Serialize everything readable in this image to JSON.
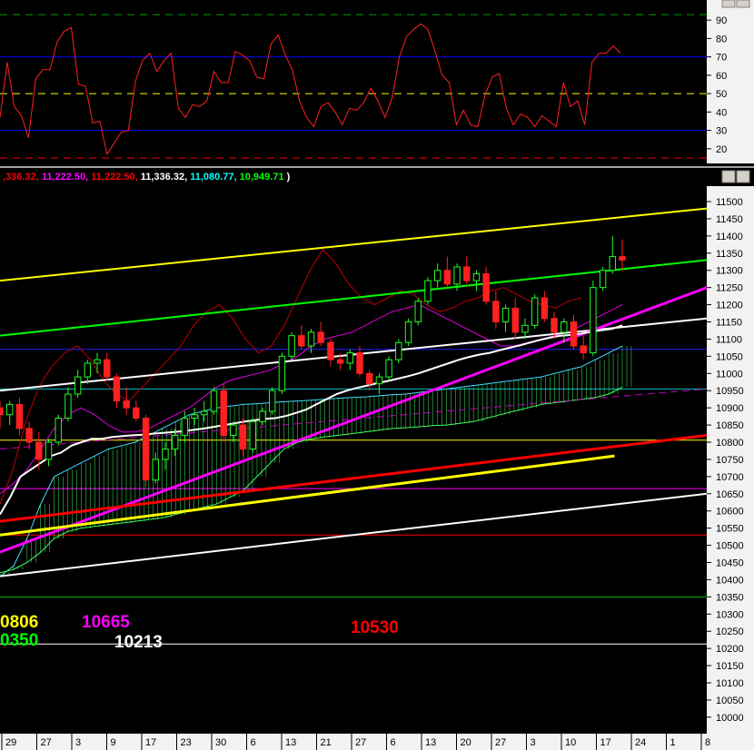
{
  "window": {
    "buttons": [
      {
        "name": "window-restore-icon"
      },
      {
        "name": "window-close-icon"
      }
    ]
  },
  "header": {
    "ohlc_segments": [
      {
        "text": ",336.32, ",
        "color": "#ff0000"
      },
      {
        "text": "11,222.50, ",
        "color": "#ff00ff"
      },
      {
        "text": "11,222.50, ",
        "color": "#ff0000"
      },
      {
        "text": "11,336.32, ",
        "color": "#ffffff"
      },
      {
        "text": "11,080.77, ",
        "color": "#00ffff"
      },
      {
        "text": "10,949.71",
        "color": "#00ff00"
      },
      {
        "text": " )",
        "color": "#ffffff"
      }
    ]
  },
  "chart_data": [
    {
      "type": "line",
      "name": "oscillator",
      "ylim": [
        13,
        97
      ],
      "yticks": [
        90,
        80,
        70,
        60,
        50,
        40,
        30,
        20
      ],
      "reference_lines": [
        {
          "value": 93,
          "color": "#00a000",
          "style": "dashed"
        },
        {
          "value": 70,
          "color": "#0000ff",
          "style": "solid"
        },
        {
          "value": 50,
          "color": "#ffff00",
          "style": "dashed"
        },
        {
          "value": 30,
          "color": "#0000ff",
          "style": "solid"
        },
        {
          "value": 15,
          "color": "#ff0000",
          "style": "dashed"
        }
      ],
      "series": [
        {
          "color": "#ff2020",
          "values": [
            37,
            67,
            43,
            38,
            26,
            58,
            63,
            63,
            78,
            84,
            86,
            55,
            54,
            34,
            35,
            17,
            23,
            29,
            30,
            57,
            68,
            72,
            62,
            68,
            72,
            42,
            37,
            44,
            43,
            46,
            62,
            56,
            56,
            73,
            71,
            68,
            59,
            58,
            77,
            82,
            71,
            63,
            46,
            37,
            32,
            43,
            45,
            40,
            33,
            42,
            41,
            45,
            53,
            46,
            37,
            48,
            70,
            81,
            85,
            88,
            85,
            73,
            60,
            56,
            33,
            41,
            33,
            32,
            49,
            59,
            61,
            42,
            33,
            39,
            37,
            32,
            38,
            35,
            32,
            56,
            43,
            46,
            33,
            67,
            72,
            72,
            76,
            72
          ]
        }
      ]
    },
    {
      "type": "candlestick",
      "name": "price",
      "ylim": [
        9960,
        11545
      ],
      "yticks": [
        11500,
        11450,
        11400,
        11350,
        11300,
        11250,
        11200,
        11150,
        11100,
        11050,
        11000,
        10950,
        10900,
        10850,
        10800,
        10750,
        10700,
        10650,
        10600,
        10550,
        10500,
        10450,
        10400,
        10350,
        10300,
        10250,
        10200,
        10150,
        10100,
        10050,
        10000
      ],
      "x_labels": [
        "29",
        "27",
        "3",
        "9",
        "17",
        "23",
        "30",
        "6",
        "13",
        "21",
        "27",
        "6",
        "13",
        "20",
        "27",
        "3",
        "10",
        "17",
        "24",
        "1",
        "8"
      ],
      "candles": [
        {
          "o": 10900,
          "h": 10920,
          "l": 10840,
          "c": 10880
        },
        {
          "o": 10880,
          "h": 10920,
          "l": 10850,
          "c": 10910
        },
        {
          "o": 10910,
          "h": 10930,
          "l": 10820,
          "c": 10840
        },
        {
          "o": 10840,
          "h": 10860,
          "l": 10780,
          "c": 10800
        },
        {
          "o": 10800,
          "h": 10830,
          "l": 10720,
          "c": 10750
        },
        {
          "o": 10750,
          "h": 10810,
          "l": 10730,
          "c": 10800
        },
        {
          "o": 10800,
          "h": 10880,
          "l": 10790,
          "c": 10870
        },
        {
          "o": 10870,
          "h": 10960,
          "l": 10860,
          "c": 10940
        },
        {
          "o": 10940,
          "h": 11010,
          "l": 10930,
          "c": 10990
        },
        {
          "o": 10990,
          "h": 11040,
          "l": 10970,
          "c": 11030
        },
        {
          "o": 11030,
          "h": 11060,
          "l": 11000,
          "c": 11040
        },
        {
          "o": 11040,
          "h": 11060,
          "l": 10980,
          "c": 10990
        },
        {
          "o": 10990,
          "h": 11000,
          "l": 10900,
          "c": 10920
        },
        {
          "o": 10920,
          "h": 10960,
          "l": 10880,
          "c": 10900
        },
        {
          "o": 10900,
          "h": 10920,
          "l": 10860,
          "c": 10870
        },
        {
          "o": 10870,
          "h": 10880,
          "l": 10670,
          "c": 10690
        },
        {
          "o": 10690,
          "h": 10770,
          "l": 10680,
          "c": 10750
        },
        {
          "o": 10750,
          "h": 10800,
          "l": 10720,
          "c": 10780
        },
        {
          "o": 10780,
          "h": 10840,
          "l": 10760,
          "c": 10820
        },
        {
          "o": 10820,
          "h": 10890,
          "l": 10800,
          "c": 10870
        },
        {
          "o": 10870,
          "h": 10900,
          "l": 10850,
          "c": 10880
        },
        {
          "o": 10880,
          "h": 10920,
          "l": 10860,
          "c": 10890
        },
        {
          "o": 10890,
          "h": 10960,
          "l": 10880,
          "c": 10950
        },
        {
          "o": 10950,
          "h": 10970,
          "l": 10800,
          "c": 10820
        },
        {
          "o": 10820,
          "h": 10860,
          "l": 10800,
          "c": 10850
        },
        {
          "o": 10850,
          "h": 10870,
          "l": 10760,
          "c": 10780
        },
        {
          "o": 10780,
          "h": 10870,
          "l": 10770,
          "c": 10860
        },
        {
          "o": 10860,
          "h": 10900,
          "l": 10850,
          "c": 10890
        },
        {
          "o": 10890,
          "h": 10960,
          "l": 10880,
          "c": 10950
        },
        {
          "o": 10950,
          "h": 11060,
          "l": 10940,
          "c": 11050
        },
        {
          "o": 11050,
          "h": 11120,
          "l": 11040,
          "c": 11110
        },
        {
          "o": 11110,
          "h": 11140,
          "l": 11070,
          "c": 11080
        },
        {
          "o": 11080,
          "h": 11130,
          "l": 11060,
          "c": 11120
        },
        {
          "o": 11120,
          "h": 11150,
          "l": 11080,
          "c": 11090
        },
        {
          "o": 11090,
          "h": 11100,
          "l": 11020,
          "c": 11040
        },
        {
          "o": 11040,
          "h": 11060,
          "l": 11010,
          "c": 11030
        },
        {
          "o": 11030,
          "h": 11070,
          "l": 11010,
          "c": 11060
        },
        {
          "o": 11060,
          "h": 11080,
          "l": 10990,
          "c": 11000
        },
        {
          "o": 11000,
          "h": 11010,
          "l": 10950,
          "c": 10970
        },
        {
          "o": 10970,
          "h": 11000,
          "l": 10940,
          "c": 10990
        },
        {
          "o": 10990,
          "h": 11050,
          "l": 10980,
          "c": 11040
        },
        {
          "o": 11040,
          "h": 11100,
          "l": 11030,
          "c": 11090
        },
        {
          "o": 11090,
          "h": 11160,
          "l": 11080,
          "c": 11150
        },
        {
          "o": 11150,
          "h": 11220,
          "l": 11140,
          "c": 11210
        },
        {
          "o": 11210,
          "h": 11280,
          "l": 11200,
          "c": 11270
        },
        {
          "o": 11270,
          "h": 11320,
          "l": 11250,
          "c": 11300
        },
        {
          "o": 11300,
          "h": 11340,
          "l": 11250,
          "c": 11260
        },
        {
          "o": 11260,
          "h": 11320,
          "l": 11240,
          "c": 11310
        },
        {
          "o": 11310,
          "h": 11340,
          "l": 11260,
          "c": 11270
        },
        {
          "o": 11270,
          "h": 11300,
          "l": 11240,
          "c": 11290
        },
        {
          "o": 11290,
          "h": 11310,
          "l": 11200,
          "c": 11210
        },
        {
          "o": 11210,
          "h": 11240,
          "l": 11130,
          "c": 11150
        },
        {
          "o": 11150,
          "h": 11200,
          "l": 11120,
          "c": 11190
        },
        {
          "o": 11190,
          "h": 11220,
          "l": 11100,
          "c": 11120
        },
        {
          "o": 11120,
          "h": 11160,
          "l": 11100,
          "c": 11140
        },
        {
          "o": 11140,
          "h": 11230,
          "l": 11130,
          "c": 11220
        },
        {
          "o": 11220,
          "h": 11240,
          "l": 11150,
          "c": 11160
        },
        {
          "o": 11160,
          "h": 11180,
          "l": 11100,
          "c": 11120
        },
        {
          "o": 11120,
          "h": 11160,
          "l": 11090,
          "c": 11150
        },
        {
          "o": 11150,
          "h": 11170,
          "l": 11070,
          "c": 11080
        },
        {
          "o": 11080,
          "h": 11110,
          "l": 11040,
          "c": 11060
        },
        {
          "o": 11060,
          "h": 11270,
          "l": 11050,
          "c": 11250
        },
        {
          "o": 11250,
          "h": 11310,
          "l": 11240,
          "c": 11300
        },
        {
          "o": 11300,
          "h": 11400,
          "l": 11290,
          "c": 11340
        },
        {
          "o": 11340,
          "h": 11390,
          "l": 11300,
          "c": 11330
        }
      ],
      "guide_lines": [
        {
          "from": [
            0,
            11270
          ],
          "to": [
            92,
            11480
          ],
          "color": "#ffff00",
          "width": 2
        },
        {
          "from": [
            0,
            11110
          ],
          "to": [
            92,
            11330
          ],
          "color": "#00ff00",
          "width": 2
        },
        {
          "from": [
            0,
            10950
          ],
          "to": [
            92,
            11160
          ],
          "color": "#ffffff",
          "width": 2
        },
        {
          "from": [
            0,
            10480
          ],
          "to": [
            92,
            11250
          ],
          "color": "#ff00ff",
          "width": 3
        },
        {
          "from": [
            0,
            10570
          ],
          "to": [
            92,
            10820
          ],
          "color": "#ff0000",
          "width": 3
        },
        {
          "from": [
            0,
            10530
          ],
          "to": [
            80,
            10760
          ],
          "color": "#ffff00",
          "width": 3
        },
        {
          "from": [
            0,
            10410
          ],
          "to": [
            92,
            10650
          ],
          "color": "#ffffff",
          "width": 2
        },
        {
          "from": [
            0,
            10780
          ],
          "to": [
            92,
            10955
          ],
          "color": "#c000c0",
          "width": 1,
          "dash": true
        }
      ],
      "horizontal_lines": [
        {
          "value": 11070,
          "color": "#2020ff"
        },
        {
          "value": 10955,
          "color": "#00c0c0"
        },
        {
          "value": 10806,
          "color": "#ffff00"
        },
        {
          "value": 10665,
          "color": "#ff00ff"
        },
        {
          "value": 10530,
          "color": "#ff0000"
        },
        {
          "value": 10350,
          "color": "#00c000"
        },
        {
          "value": 10213,
          "color": "#ffffff"
        }
      ],
      "level_labels": [
        {
          "text": "0806",
          "color": "#ffff00",
          "pos": "a"
        },
        {
          "text": "0350",
          "color": "#00ff00",
          "pos": "b"
        },
        {
          "text": "10665",
          "color": "#ff00ff",
          "pos": "c"
        },
        {
          "text": "10213",
          "color": "#ffffff",
          "pos": "d"
        },
        {
          "text": "10530",
          "color": "#ff0000",
          "pos": "e"
        }
      ],
      "ma_white": [
        10590,
        10640,
        10700,
        10720,
        10740,
        10760,
        10770,
        10790,
        10800,
        10810,
        10810,
        10815,
        10818,
        10820,
        10822,
        10825,
        10827,
        10830,
        10832,
        10836,
        10840,
        10845,
        10850,
        10855,
        10860,
        10864,
        10868,
        10870,
        10876,
        10885,
        10895,
        10910,
        10925,
        10940,
        10950,
        10958,
        10965,
        10972,
        10978,
        10985,
        10992,
        11000,
        11010,
        11020,
        11030,
        11040,
        11048,
        11055,
        11060,
        11068,
        11075,
        11082,
        11090,
        11098,
        11105,
        11110,
        11112,
        11116,
        11122,
        11126,
        11130,
        11140
      ],
      "ma_magenta": [
        10650,
        10680,
        10720,
        10780,
        10840,
        10880,
        10900,
        10880,
        10850,
        10830,
        10830,
        10840,
        10860,
        10880,
        10900,
        10930,
        10960,
        10980,
        10990,
        11000,
        11010,
        11030,
        11050,
        11080,
        11100,
        11110,
        11120,
        11140,
        11160,
        11180,
        11190,
        11200,
        11180,
        11160,
        11140,
        11120,
        11100,
        11080,
        11080,
        11090,
        11100,
        11110,
        11120,
        11140,
        11160,
        11180,
        11200
      ],
      "lagging_red": [
        10620,
        10720,
        10860,
        10960,
        11020,
        11060,
        11080,
        11040,
        10980,
        10940,
        10920,
        10960,
        11000,
        11040,
        11080,
        11140,
        11180,
        11200,
        11160,
        11100,
        11060,
        11080,
        11140,
        11220,
        11300,
        11360,
        11320,
        11260,
        11220,
        11200,
        11220,
        11240,
        11230,
        11200,
        11180,
        11190,
        11210,
        11220,
        11240,
        11250,
        11230,
        11210,
        11200,
        11190,
        11210,
        11220
      ],
      "cloud_top": [
        10410,
        10440,
        10520,
        10620,
        10700,
        10720,
        10740,
        10760,
        10780,
        10790,
        10800,
        10820,
        10840,
        10860,
        10880,
        10890,
        10900,
        10905,
        10910,
        10912,
        10915,
        10918,
        10920,
        10922,
        10925,
        10928,
        10930,
        10932,
        10935,
        10938,
        10940,
        10945,
        10950,
        10955,
        10960,
        10965,
        10970,
        10975,
        10980,
        10985,
        10990,
        11000,
        11010,
        11020,
        11040,
        11060,
        11080
      ],
      "cloud_bottom": [
        10420,
        10430,
        10450,
        10480,
        10520,
        10540,
        10550,
        10555,
        10560,
        10565,
        10570,
        10575,
        10580,
        10590,
        10600,
        10610,
        10620,
        10640,
        10660,
        10700,
        10740,
        10780,
        10800,
        10810,
        10815,
        10820,
        10825,
        10830,
        10835,
        10840,
        10842,
        10845,
        10848,
        10850,
        10855,
        10860,
        10870,
        10880,
        10890,
        10900,
        10910,
        10915,
        10920,
        10925,
        10930,
        10940,
        10960
      ]
    }
  ]
}
